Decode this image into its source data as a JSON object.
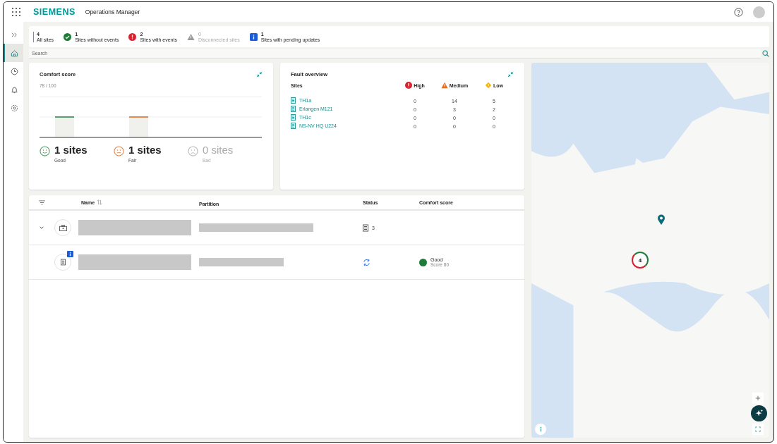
{
  "app": {
    "brand": "SIEMENS",
    "title": "Operations Manager"
  },
  "sidebar": [
    {
      "kind": "expand",
      "selected": false
    },
    {
      "kind": "home",
      "selected": true
    },
    {
      "kind": "clock",
      "selected": false
    },
    {
      "kind": "bell",
      "selected": false
    },
    {
      "kind": "gear",
      "selected": false
    }
  ],
  "summary": [
    {
      "kind": "all",
      "count": "4",
      "label": "All sites",
      "disabled": false
    },
    {
      "kind": "ok",
      "count": "1",
      "label": "Sites without events",
      "disabled": false
    },
    {
      "kind": "error",
      "count": "2",
      "label": "Sites with events",
      "disabled": false
    },
    {
      "kind": "warning",
      "count": "0",
      "label": "Disconnected sites",
      "disabled": true
    },
    {
      "kind": "info",
      "count": "1",
      "label": "Sites with pending updates",
      "disabled": false
    }
  ],
  "search": {
    "placeholder": "Search"
  },
  "comfort_card": {
    "title": "Comfort score",
    "score": "78 / 100",
    "groups": [
      {
        "kind": "good",
        "count": "1 sites",
        "label": "Good",
        "disabled": false
      },
      {
        "kind": "fair",
        "count": "1 sites",
        "label": "Fair",
        "disabled": false
      },
      {
        "kind": "bad",
        "count": "0 sites",
        "label": "Bad",
        "disabled": true
      }
    ]
  },
  "fault_card": {
    "title": "Fault overview",
    "columns": [
      {
        "kind": "site",
        "label": "Sites"
      },
      {
        "kind": "high",
        "label": "High"
      },
      {
        "kind": "medium",
        "label": "Medium"
      },
      {
        "kind": "low",
        "label": "Low"
      }
    ],
    "rows": [
      {
        "site": "TH1a",
        "high": "0",
        "medium": "14",
        "low": "5"
      },
      {
        "site": "Erlangen M121",
        "high": "0",
        "medium": "3",
        "low": "2"
      },
      {
        "site": "TH1c",
        "high": "0",
        "medium": "0",
        "low": "0"
      },
      {
        "site": "NS-NV HQ U224",
        "high": "0",
        "medium": "0",
        "low": "0"
      }
    ]
  },
  "table": {
    "columns": [
      {
        "kind": "filter"
      },
      {
        "kind": "name",
        "label": "Name"
      },
      {
        "kind": "partition",
        "label": "Partition"
      },
      {
        "kind": "status",
        "label": "Status"
      },
      {
        "kind": "comfort",
        "label": "Comfort score"
      }
    ],
    "rows": [
      {
        "kind": "group",
        "expanded": true,
        "status": "3",
        "children": [
          {
            "kind": "site",
            "comfort": {
              "label": "Good",
              "score": "Score 80",
              "color": "#1e7b3a"
            }
          }
        ]
      }
    ]
  },
  "map": {
    "cluster_count": "4"
  }
}
